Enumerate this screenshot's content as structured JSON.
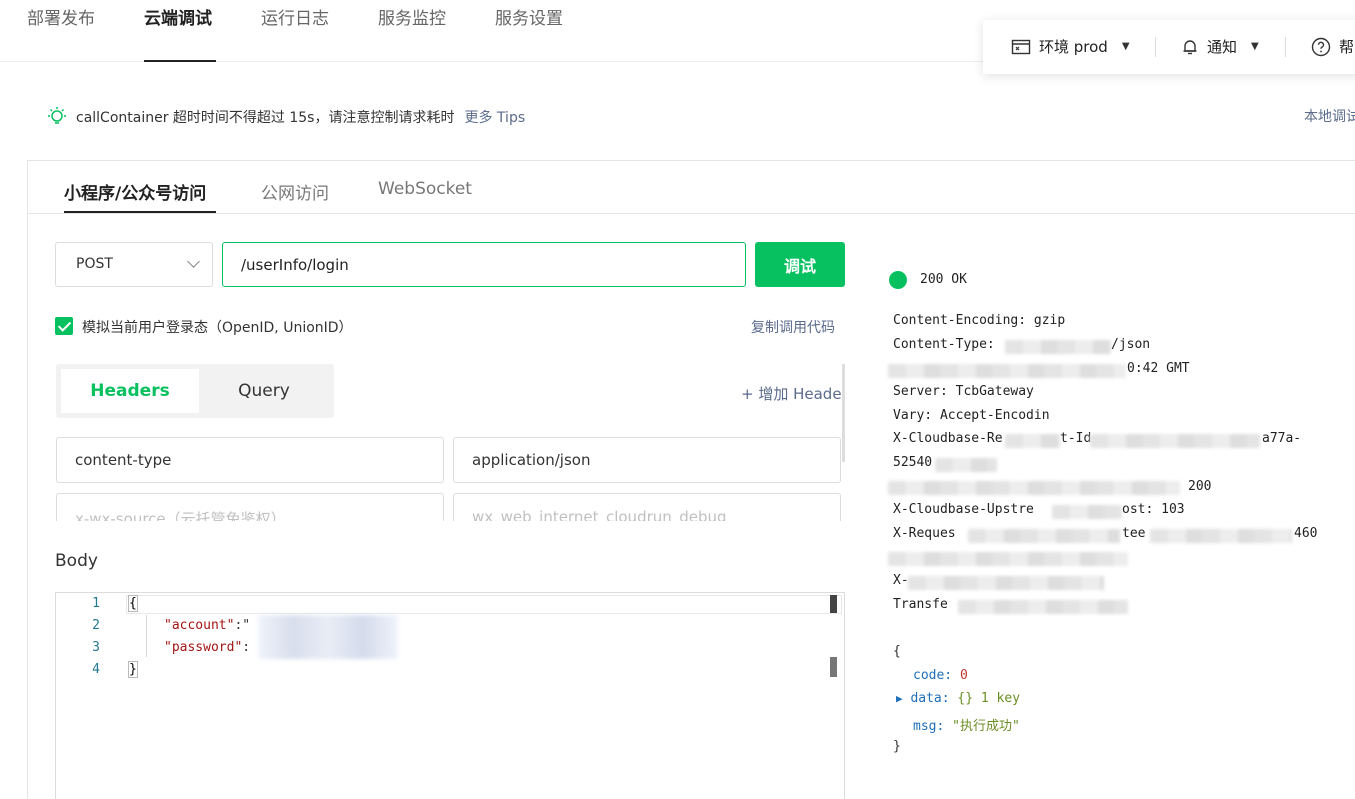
{
  "top_tabs": [
    "部署发布",
    "云端调试",
    "运行日志",
    "服务监控",
    "服务设置"
  ],
  "env_bar": {
    "env_label": "环境 prod",
    "notify_label": "通知",
    "help_label": "帮"
  },
  "tip": {
    "text": "callContainer 超时时间不得超过 15s，请注意控制请求耗时",
    "link": "更多 Tips",
    "local_debug": "本地调试"
  },
  "sub_tabs": [
    "小程序/公众号访问",
    "公网访问",
    "WebSocket"
  ],
  "request": {
    "method": "POST",
    "path": "/userInfo/login",
    "debug_button": "调试",
    "simulate_login_label": "模拟当前用户登录态（OpenID, UnionID）",
    "copy_code": "复制调用代码"
  },
  "hq_tabs": {
    "headers": "Headers",
    "query": "Query"
  },
  "add_header": "+ 增加 Header",
  "headers": [
    {
      "key": "content-type",
      "value": "application/json"
    },
    {
      "key": "x-wx-source（云托管免鉴权）",
      "value": "wx_web_internet_cloudrun_debug"
    }
  ],
  "body": {
    "label": "Body",
    "lines": [
      "1",
      "2",
      "3",
      "4"
    ],
    "open_brace": "{",
    "close_brace": "}",
    "account_key": "\"account\"",
    "account_sep": ":\"",
    "password_key": "\"password\"",
    "password_sep": ":"
  },
  "response": {
    "status": "200 OK",
    "headers": [
      "Content-Encoding: gzip",
      "Content-Type:",
      "/json",
      "0:42 GMT",
      "Server: TcbGateway",
      "Vary: Accept-Encodin",
      "X-Cloudbase-Re",
      "t-Id",
      "a77a-",
      "52540",
      "200",
      "X-Cloudbase-Upstre",
      "ost: 103",
      "X-Reques",
      "tee",
      "460",
      "X-",
      "Transfe"
    ],
    "json": {
      "open": "{",
      "code_key": "code:",
      "code_val": "0",
      "data_key": "data:",
      "data_val": "{}",
      "data_meta": "1 key",
      "msg_key": "msg:",
      "msg_val": "\"执行成功\"",
      "close": "}"
    }
  },
  "colors": {
    "accent": "#07c160",
    "link": "#5b6b8c"
  }
}
